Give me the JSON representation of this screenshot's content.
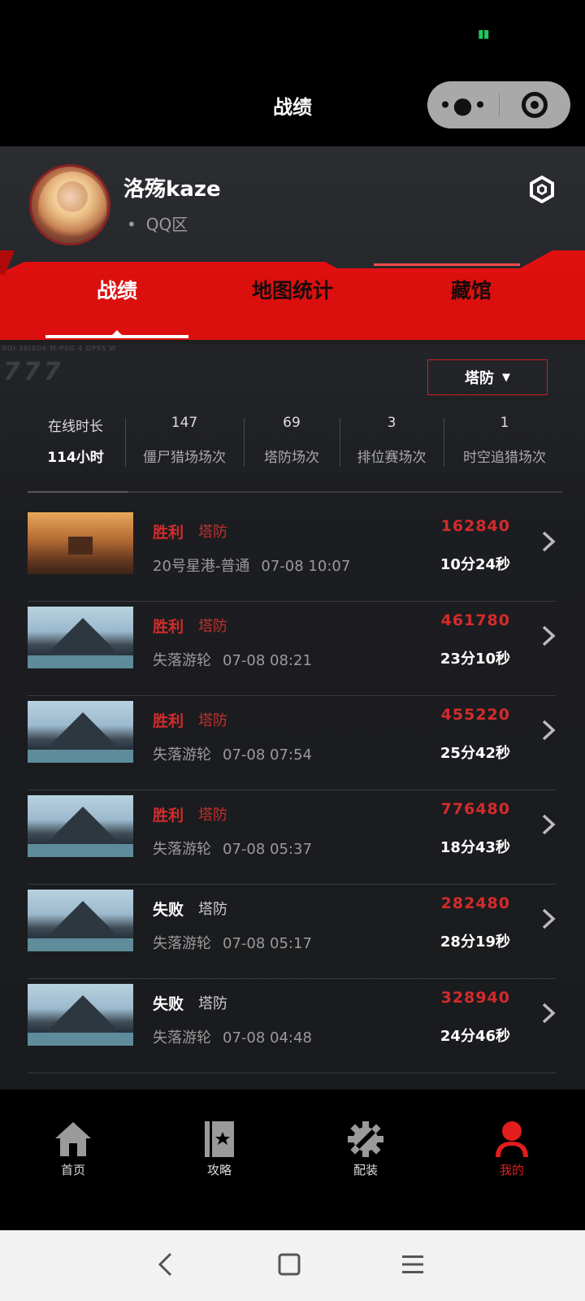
{
  "status_bar": {
    "battery": "▮▮"
  },
  "title_bar": {
    "title": "战绩",
    "more_glyph": "•●•"
  },
  "profile": {
    "name": "洛殇kaze",
    "server": "QQ区"
  },
  "tabs": [
    {
      "label": "战绩",
      "active": true
    },
    {
      "label": "地图统计",
      "active": false
    },
    {
      "label": "藏馆",
      "active": false
    }
  ],
  "deco_text": "NOI 30ISO6 M-PSG 4  DPSS  W",
  "deco_mark": "777",
  "mode_select": {
    "label": "塔防",
    "arrow": "▼"
  },
  "stats": [
    {
      "top": "在线时长",
      "bottom": "114小时"
    },
    {
      "top": "147",
      "bottom": "僵尸猎场场次"
    },
    {
      "top": "69",
      "bottom": "塔防场次"
    },
    {
      "top": "3",
      "bottom": "排位赛场次"
    },
    {
      "top": "1",
      "bottom": "时空追猎场次"
    }
  ],
  "matches": [
    {
      "result": "胜利",
      "mode": "塔防",
      "map": "20号星港-普通",
      "time": "07-08 10:07",
      "score": "162840",
      "duration": "10分24秒"
    },
    {
      "result": "胜利",
      "mode": "塔防",
      "map": "失落游轮",
      "time": "07-08 08:21",
      "score": "461780",
      "duration": "23分10秒"
    },
    {
      "result": "胜利",
      "mode": "塔防",
      "map": "失落游轮",
      "time": "07-08 07:54",
      "score": "455220",
      "duration": "25分42秒"
    },
    {
      "result": "胜利",
      "mode": "塔防",
      "map": "失落游轮",
      "time": "07-08 05:37",
      "score": "776480",
      "duration": "18分43秒"
    },
    {
      "result": "失败",
      "mode": "塔防",
      "map": "失落游轮",
      "time": "07-08 05:17",
      "score": "282480",
      "duration": "28分19秒"
    },
    {
      "result": "失败",
      "mode": "塔防",
      "map": "失落游轮",
      "time": "07-08 04:48",
      "score": "328940",
      "duration": "24分46秒"
    }
  ],
  "bottom_nav": [
    {
      "label": "首页",
      "icon": "home-icon"
    },
    {
      "label": "攻略",
      "icon": "guide-book-icon"
    },
    {
      "label": "配装",
      "icon": "gear-wrench-icon"
    },
    {
      "label": "我的",
      "icon": "user-icon",
      "active": true
    }
  ],
  "colors": {
    "accent_red": "#e01010",
    "win_red": "#d42b2b",
    "bg": "#1c1d20"
  }
}
